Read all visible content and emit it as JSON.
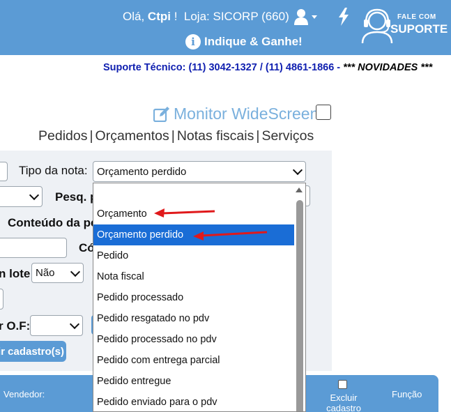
{
  "header": {
    "greeting_prefix": "Olá,",
    "user_name": "Ctpi",
    "greeting_suffix": "!",
    "store_label": "Loja: SICORP (660)",
    "indique_label": "Indique & Ganhe!",
    "support_small": "FALE COM",
    "support_big": "SUPORTE"
  },
  "support_line": {
    "text": "Suporte Técnico: (11) 3042-1327 / (11) 4861-1866 -",
    "news": "*** NOVIDADES ***"
  },
  "monitor": {
    "label": "Monitor WideScreen",
    "checked": false
  },
  "tabs": [
    {
      "label": "Pedidos"
    },
    {
      "label": "Orçamentos"
    },
    {
      "label": "Notas fiscais"
    },
    {
      "label": "Serviços"
    }
  ],
  "filters": {
    "tipo_label": "Tipo da nota:",
    "tipo_value": "Orçamento perdido",
    "pesq_label": "Pesq. p",
    "conteudo_label": "Conteúdo da pe",
    "co_label": "Có",
    "lote_label": "n lote:",
    "lote_value": "Não",
    "of_label": "r O.F:",
    "incluir_button": "ir cadastro(s)"
  },
  "dropdown": {
    "options": [
      {
        "label": "Orçamento",
        "selected": false
      },
      {
        "label": "Orçamento perdido",
        "selected": true
      },
      {
        "label": "Pedido",
        "selected": false
      },
      {
        "label": "Nota fiscal",
        "selected": false
      },
      {
        "label": "Pedido processado",
        "selected": false
      },
      {
        "label": "Pedido resgatado no pdv",
        "selected": false
      },
      {
        "label": "Pedido processado no pdv",
        "selected": false
      },
      {
        "label": "Pedido com entrega parcial",
        "selected": false
      },
      {
        "label": "Pedido entregue",
        "selected": false
      },
      {
        "label": "Pedido enviado para o pdv",
        "selected": false
      }
    ]
  },
  "bottombar": {
    "vendedor": "Vendedor:",
    "excluir": "Excluir cadastro",
    "funcao": "Função"
  },
  "colors": {
    "brand_blue": "#5b9bd5",
    "selected_blue": "#1a6dd6",
    "annotation_red": "#e0191b"
  },
  "icons": [
    "user-icon",
    "bolt-icon",
    "headset-icon",
    "info-icon",
    "edit-icon",
    "chevron-down-icon"
  ]
}
